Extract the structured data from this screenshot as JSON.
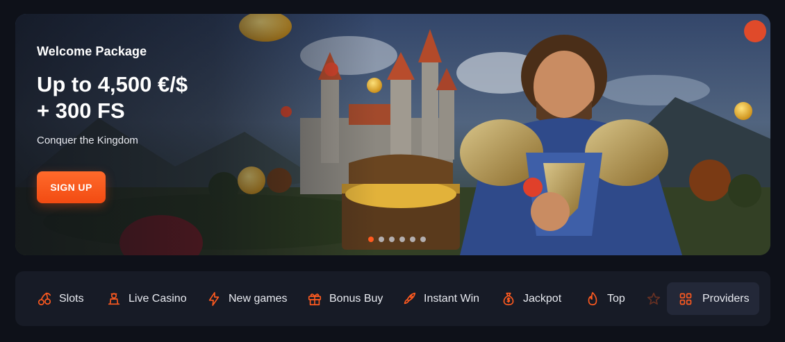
{
  "banner": {
    "eyebrow": "Welcome Package",
    "headline_line1": "Up to 4,500 €/$",
    "headline_line2": "+ 300 FS",
    "subtitle": "Conquer the Kingdom",
    "cta_label": "SIGN UP",
    "carousel": {
      "total_slides": 6,
      "active_slide": 1
    }
  },
  "categories": [
    {
      "label": "Slots",
      "icon": "cherries-icon"
    },
    {
      "label": "Live Casino",
      "icon": "dealer-icon"
    },
    {
      "label": "New games",
      "icon": "lightning-icon"
    },
    {
      "label": "Bonus Buy",
      "icon": "gift-box-icon"
    },
    {
      "label": "Instant Win",
      "icon": "rocket-icon"
    },
    {
      "label": "Jackpot",
      "icon": "money-bag-icon"
    },
    {
      "label": "Top",
      "icon": "flame-icon"
    },
    {
      "label": "",
      "icon": "star-icon"
    }
  ],
  "providers": {
    "label": "Providers",
    "icon": "grid-icon"
  },
  "colors": {
    "accent": "#ff5a1f",
    "background": "#0e1119",
    "panel": "#171b26",
    "providers_bg": "#232838",
    "text": "#e9ebf1"
  }
}
